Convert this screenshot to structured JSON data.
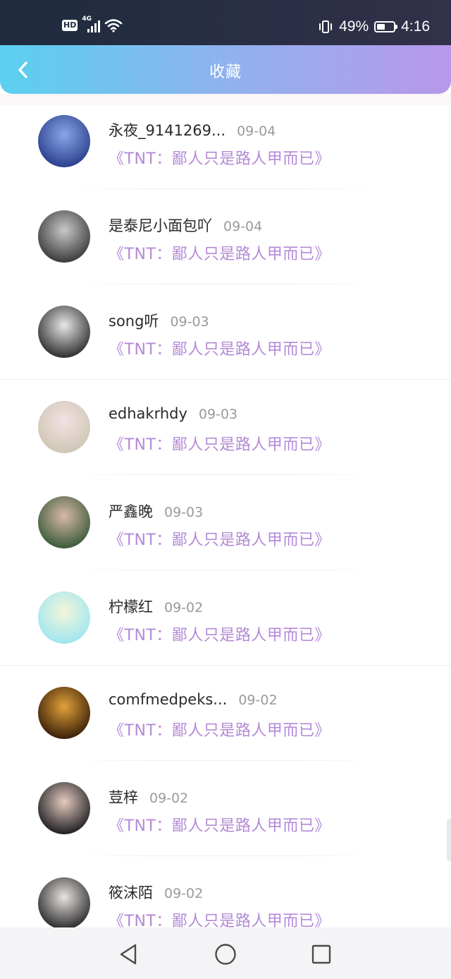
{
  "status_bar": {
    "hd": "HD",
    "network": "4G",
    "battery_percent": "49%",
    "battery_level": 0.49,
    "time": "4:16"
  },
  "header": {
    "title": "收藏",
    "back_icon": "chevron-left-icon"
  },
  "items": [
    {
      "name": "永夜_9141269...",
      "date": "09-04",
      "work": "《TNT：鄙人只是路人甲而已》",
      "avatar_colors": [
        "#2b3f8e",
        "#8aa6e8"
      ]
    },
    {
      "name": "是泰尼小面包吖",
      "date": "09-04",
      "work": "《TNT：鄙人只是路人甲而已》",
      "avatar_colors": [
        "#3a3a3a",
        "#c9c9c9"
      ]
    },
    {
      "name": "song听",
      "date": "09-03",
      "work": "《TNT：鄙人只是路人甲而已》",
      "avatar_colors": [
        "#2e2e2e",
        "#e8e8e8"
      ]
    },
    {
      "name": "edhakrhdy",
      "date": "09-03",
      "work": "《TNT：鄙人只是路人甲而已》",
      "avatar_colors": [
        "#cfc6b4",
        "#f2e2e4"
      ]
    },
    {
      "name": "严鑫晚",
      "date": "09-03",
      "work": "《TNT：鄙人只是路人甲而已》",
      "avatar_colors": [
        "#3b5a3a",
        "#d8b9a6"
      ]
    },
    {
      "name": "柠檬红",
      "date": "09-02",
      "work": "《TNT：鄙人只是路人甲而已》",
      "avatar_colors": [
        "#9fe6f0",
        "#f3f6da"
      ]
    },
    {
      "name": "comfmedpeks...",
      "date": "09-02",
      "work": "《TNT：鄙人只是路人甲而已》",
      "avatar_colors": [
        "#3a1f08",
        "#e2a23a"
      ]
    },
    {
      "name": "荳梓",
      "date": "09-02",
      "work": "《TNT：鄙人只是路人甲而已》",
      "avatar_colors": [
        "#1e1e22",
        "#e6cbc0"
      ]
    },
    {
      "name": "筱沫陌",
      "date": "09-02",
      "work": "《TNT：鄙人只是路人甲而已》",
      "avatar_colors": [
        "#2a2a2a",
        "#e9e4e2"
      ]
    }
  ],
  "nav": {
    "back_icon": "triangle-back-icon",
    "home_icon": "circle-home-icon",
    "recents_icon": "square-recents-icon"
  },
  "colors": {
    "header_gradient_start": "#5ad1ee",
    "header_gradient_end": "#b898e9",
    "work_title": "#b48ad8",
    "date": "#9a9a9a"
  }
}
